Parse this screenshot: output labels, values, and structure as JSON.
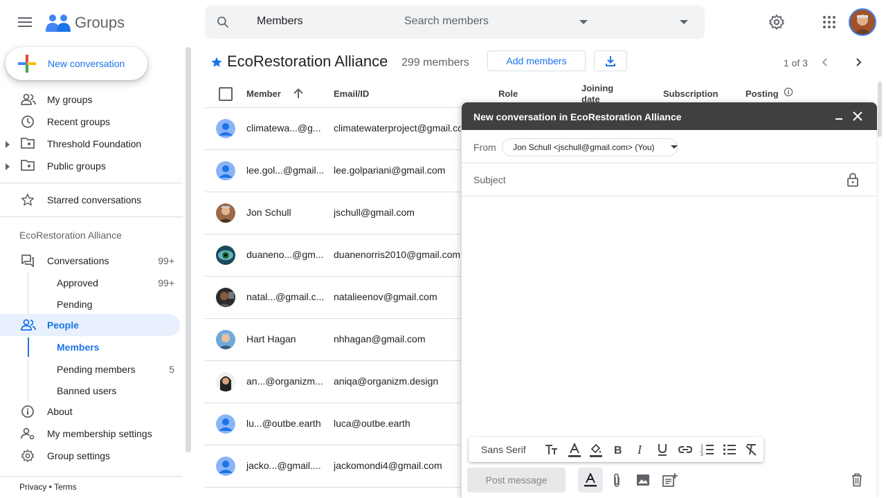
{
  "app": {
    "name": "Groups"
  },
  "search": {
    "scope": "Members",
    "placeholder": "Search members"
  },
  "nav": {
    "new_conversation": "New conversation",
    "my_groups": "My groups",
    "recent_groups": "Recent groups",
    "threshold": "Threshold Foundation",
    "public_groups": "Public groups",
    "starred": "Starred conversations",
    "group_name": "EcoRestoration Alliance",
    "conversations": "Conversations",
    "conversations_count": "99+",
    "approved": "Approved",
    "approved_count": "99+",
    "pending": "Pending",
    "people": "People",
    "members": "Members",
    "pending_members": "Pending members",
    "pending_members_count": "5",
    "banned": "Banned users",
    "about": "About",
    "membership_settings": "My membership settings",
    "group_settings": "Group settings"
  },
  "footer": {
    "text": "Privacy • Terms"
  },
  "group": {
    "title": "EcoRestoration Alliance",
    "member_count": "299 members",
    "add_members": "Add members",
    "page_info": "1 of 3"
  },
  "table": {
    "headers": {
      "member": "Member",
      "email": "Email/ID",
      "role": "Role",
      "joining": "Joining date",
      "subscription": "Subscription",
      "posting": "Posting"
    },
    "rows": [
      {
        "name": "climatewa...@g...",
        "email": "climatewaterproject@gmail.com",
        "avatar": "default"
      },
      {
        "name": "lee.gol...@gmail...",
        "email": "lee.golpariani@gmail.com",
        "avatar": "default"
      },
      {
        "name": "Jon Schull",
        "email": "jschull@gmail.com",
        "avatar": "photo-man"
      },
      {
        "name": "duaneno...@gm...",
        "email": "duanenorris2010@gmail.com",
        "avatar": "eye"
      },
      {
        "name": "natal...@gmail.c...",
        "email": "natalieenov@gmail.com",
        "avatar": "photo-dark"
      },
      {
        "name": "Hart Hagan",
        "email": "nhhagan@gmail.com",
        "avatar": "photo-sky"
      },
      {
        "name": "an...@organizm....",
        "email": "aniqa@organizm.design",
        "avatar": "photo-woman"
      },
      {
        "name": "lu...@outbe.earth",
        "email": "luca@outbe.earth",
        "avatar": "default"
      },
      {
        "name": "jacko...@gmail....",
        "email": "jackomondi4@gmail.com",
        "avatar": "default"
      }
    ]
  },
  "compose": {
    "title": "New conversation in EcoRestoration Alliance",
    "from_label": "From",
    "from_value": "Jon Schull <jschull@gmail.com> (You)",
    "subject_placeholder": "Subject",
    "font": "Sans Serif",
    "post": "Post message"
  },
  "colors": {
    "accent": "#1a73e8",
    "active_bg": "#e8f0fe",
    "compose_header": "#404040"
  }
}
